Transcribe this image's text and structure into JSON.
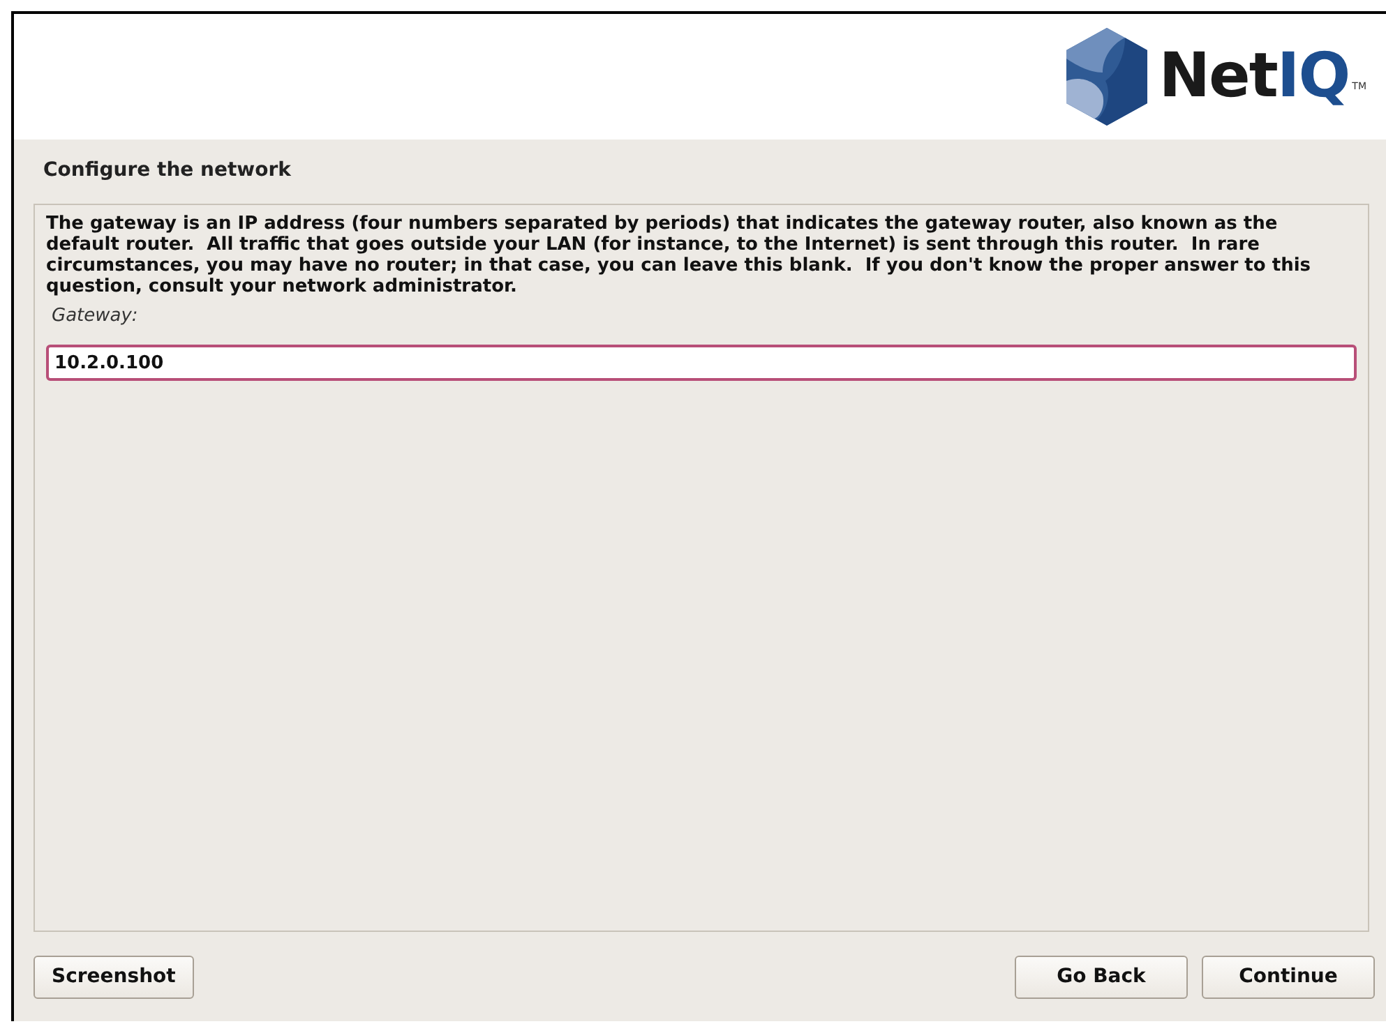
{
  "header": {
    "logo": {
      "brand": "Net",
      "brand_accent": "IQ",
      "trademark": "TM"
    }
  },
  "page_title": "Configure the network",
  "description": "The gateway is an IP address (four numbers separated by periods) that indicates the gateway router, also known as the default router.  All traffic that goes outside your LAN (for instance, to the Internet) is sent through this router.  In rare circumstances, you may have no router; in that case, you can leave this blank.  If you don't know the proper answer to this question, consult your network administrator.",
  "field": {
    "label": "Gateway:",
    "value": "10.2.0.100",
    "focused": true
  },
  "left_buttons": [
    {
      "label": "Screenshot"
    }
  ],
  "right_buttons": [
    {
      "label": "Go Back"
    },
    {
      "label": "Continue"
    }
  ]
}
